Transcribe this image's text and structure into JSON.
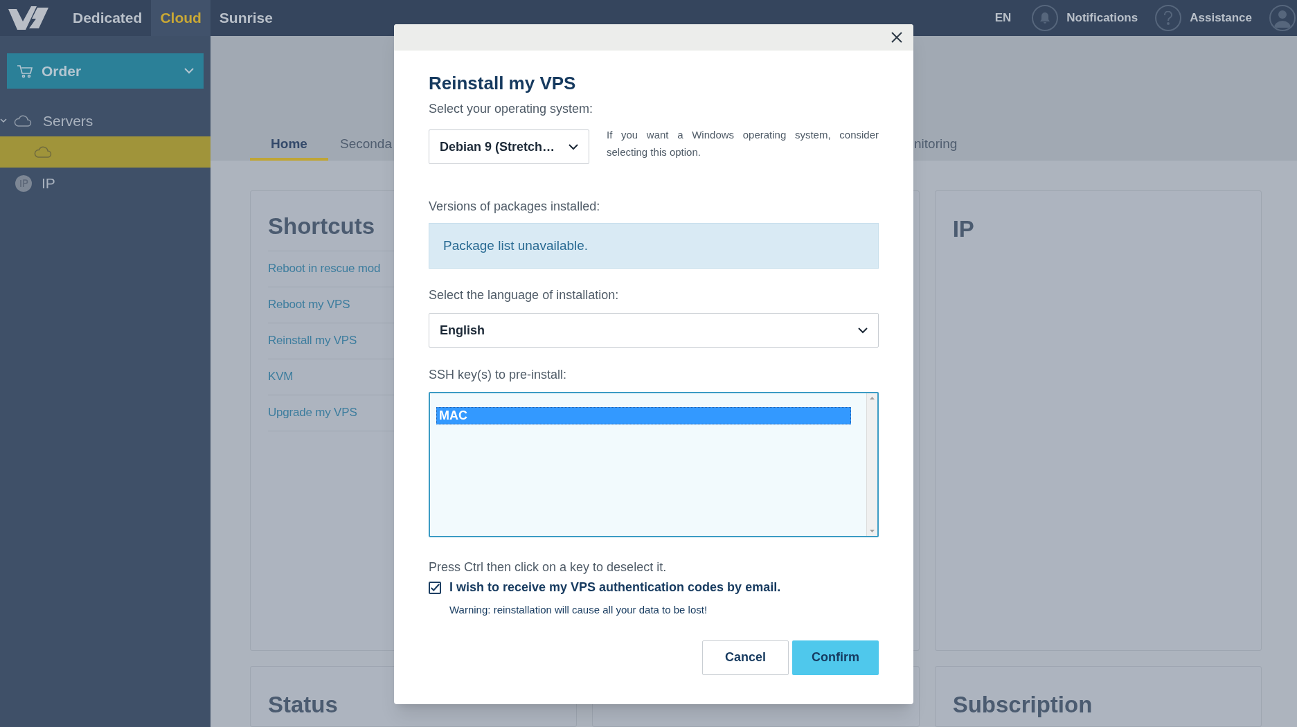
{
  "topbar": {
    "nav": [
      {
        "label": "Dedicated",
        "selected": false
      },
      {
        "label": "Cloud",
        "selected": true
      },
      {
        "label": "Sunrise",
        "selected": false
      }
    ],
    "language": "EN",
    "notifications": "Notifications",
    "assistance": "Assistance"
  },
  "sidebar": {
    "order_button": "Order",
    "items": [
      {
        "kind": "group",
        "label": "Servers",
        "expanded": true,
        "selected": false
      },
      {
        "kind": "server",
        "selected": true
      },
      {
        "kind": "ip",
        "label": "IP",
        "selected": false
      }
    ]
  },
  "tabs": [
    {
      "label": "Home",
      "selected": true
    },
    {
      "label": "Seconda",
      "selected": false
    },
    {
      "label": "nitoring",
      "selected": false
    }
  ],
  "shortcuts": {
    "title": "Shortcuts",
    "links": [
      "Reboot in rescue mod",
      "Reboot my VPS",
      "Reinstall my VPS",
      "KVM",
      "Upgrade my VPS"
    ]
  },
  "ip_card": {
    "title": "IP"
  },
  "bottom_cards": [
    "Status",
    "Subscription"
  ],
  "modal": {
    "title": "Reinstall my VPS",
    "os_label": "Select your operating system:",
    "os_value": "Debian 9 (Stretch…",
    "os_hint": "If you want a Windows operating system, consider selecting this option.",
    "packages_label": "Versions of packages installed:",
    "packages_message": "Package list unavailable.",
    "language_label": "Select the language of installation:",
    "language_value": "English",
    "ssh_label": "SSH key(s) to pre-install:",
    "ssh_keys": [
      {
        "label": "MAC",
        "selected": true
      }
    ],
    "ssh_hint": "Press Ctrl then click on a key to deselect it.",
    "email_checkbox": {
      "label": "I wish to receive my VPS authentication codes by email.",
      "checked": true
    },
    "warning": "Warning: reinstallation will cause all your data to be lost!",
    "cancel": "Cancel",
    "confirm": "Confirm"
  }
}
